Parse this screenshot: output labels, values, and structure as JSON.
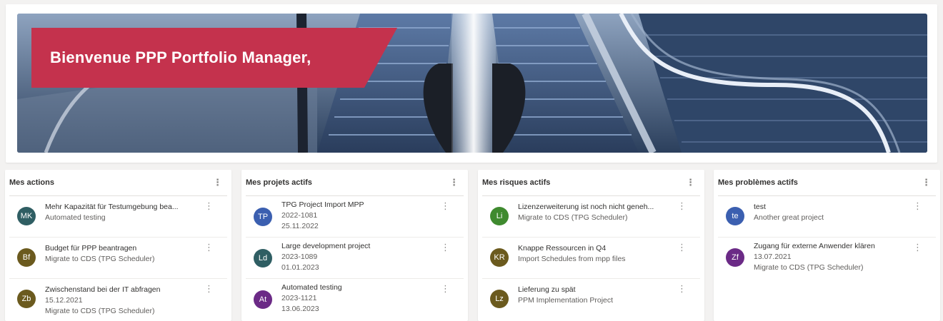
{
  "hero": {
    "title": "Bienvenue PPP Portfolio Manager,"
  },
  "panels": [
    {
      "title": "Mes actions",
      "items": [
        {
          "initials": "MK",
          "color": "#2f5e63",
          "lines": [
            "Mehr Kapazität für Testumgebung bea...",
            "Automated testing"
          ]
        },
        {
          "initials": "Bf",
          "color": "#6b5a1e",
          "lines": [
            "Budget für PPP beantragen",
            "Migrate to CDS (TPG Scheduler)"
          ]
        },
        {
          "initials": "Zb",
          "color": "#6b5a1e",
          "lines": [
            "Zwischenstand bei der IT abfragen",
            "15.12.2021",
            "Migrate to CDS (TPG Scheduler)"
          ]
        }
      ]
    },
    {
      "title": "Mes projets actifs",
      "items": [
        {
          "initials": "TP",
          "color": "#3b5fb0",
          "lines": [
            "TPG Project Import MPP",
            "2022-1081",
            "25.11.2022"
          ]
        },
        {
          "initials": "Ld",
          "color": "#2f5e63",
          "lines": [
            "Large development project",
            "2023-1089",
            "01.01.2023"
          ]
        },
        {
          "initials": "At",
          "color": "#6b2a86",
          "lines": [
            "Automated testing",
            "2023-1121",
            "13.06.2023"
          ]
        }
      ]
    },
    {
      "title": "Mes risques actifs",
      "items": [
        {
          "initials": "Li",
          "color": "#3f8a2f",
          "lines": [
            "Lizenzerweiterung ist noch nicht geneh...",
            "Migrate to CDS (TPG Scheduler)"
          ]
        },
        {
          "initials": "KR",
          "color": "#6b5a1e",
          "lines": [
            "Knappe Ressourcen in Q4",
            "Import Schedules from mpp files"
          ]
        },
        {
          "initials": "Lz",
          "color": "#6b5a1e",
          "lines": [
            "Lieferung zu spät",
            "PPM Implementation Project"
          ]
        }
      ]
    },
    {
      "title": "Mes problèmes actifs",
      "items": [
        {
          "initials": "te",
          "color": "#3b5fb0",
          "lines": [
            "test",
            "Another great project"
          ]
        },
        {
          "initials": "Zf",
          "color": "#6b2a86",
          "lines": [
            "Zugang für externe Anwender klären",
            "13.07.2021",
            "Migrate to CDS (TPG Scheduler)"
          ]
        }
      ]
    }
  ],
  "menu_glyph": "⋮"
}
